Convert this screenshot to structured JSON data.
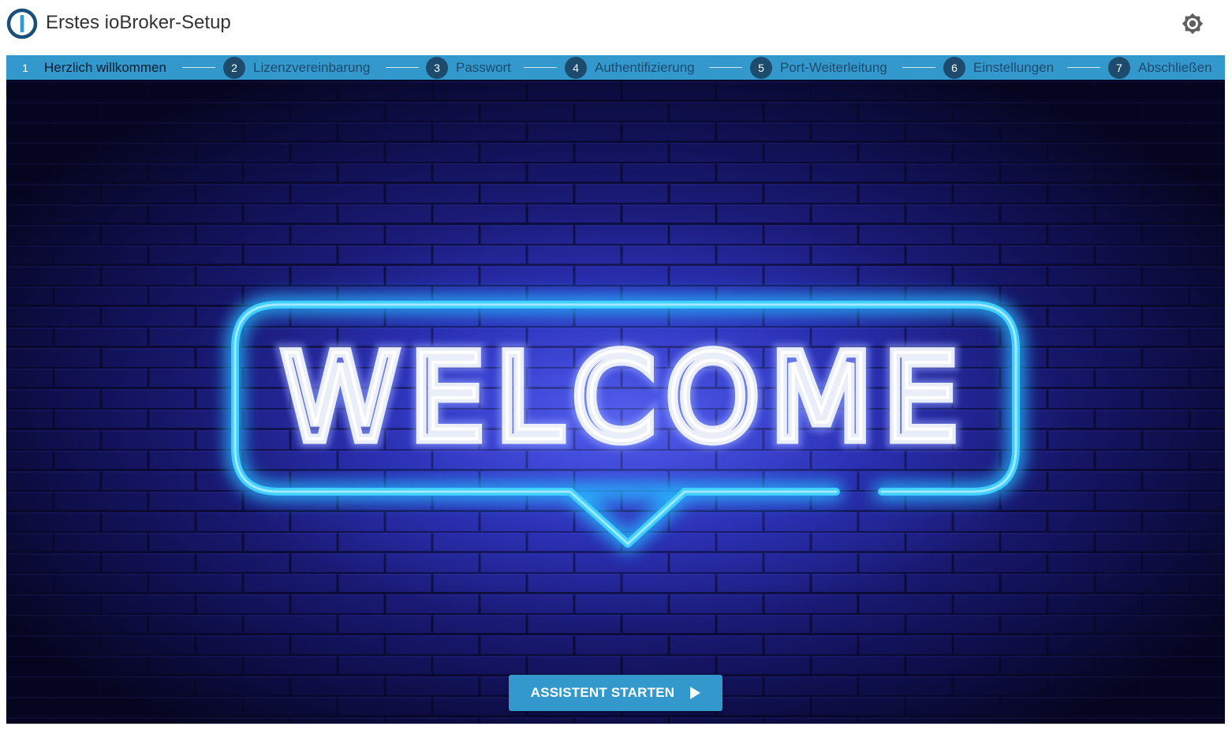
{
  "header": {
    "title": "Erstes ioBroker-Setup",
    "logo_icon": "iobroker-logo-icon",
    "theme_icon": "brightness-icon"
  },
  "stepper": {
    "steps": [
      {
        "number": "1",
        "label": "Herzlich willkommen",
        "active": true
      },
      {
        "number": "2",
        "label": "Lizenzvereinbarung",
        "active": false
      },
      {
        "number": "3",
        "label": "Passwort",
        "active": false
      },
      {
        "number": "4",
        "label": "Authentifizierung",
        "active": false
      },
      {
        "number": "5",
        "label": "Port-Weiterleitung",
        "active": false
      },
      {
        "number": "6",
        "label": "Einstellungen",
        "active": false
      },
      {
        "number": "7",
        "label": "Abschließen",
        "active": false
      }
    ]
  },
  "hero": {
    "sign_text": "WELCOME"
  },
  "actions": {
    "start_label": "ASSISTENT STARTEN"
  },
  "colors": {
    "accent": "#3399cc",
    "step_circle": "#1d4b6e",
    "neon": "#33c8ff",
    "wall": "#0a0a3a"
  }
}
